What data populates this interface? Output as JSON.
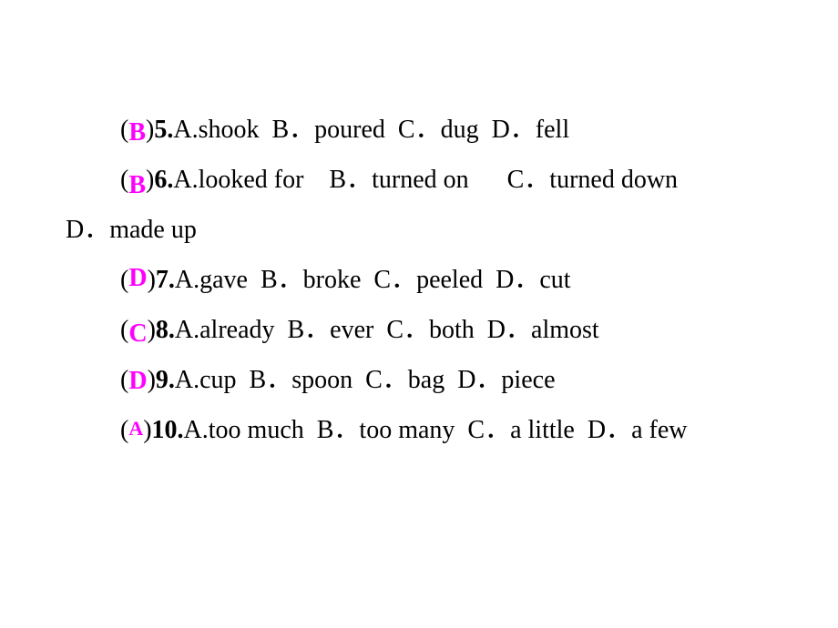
{
  "questions": [
    {
      "answer": "B",
      "number": "5.",
      "text": "A.shook  B．poured  C．dug  D．fell"
    },
    {
      "answer": "B",
      "number": "6.",
      "text": "A.looked for    B．turned on      C．turned down",
      "continuation": "D．made up"
    },
    {
      "answer": "D",
      "number": "7.",
      "text": "A.gave  B．broke  C．peeled  D．cut"
    },
    {
      "answer": "C",
      "number": "8.",
      "text": "A.already  B．ever  C．both  D．almost"
    },
    {
      "answer": "D",
      "number": "9.",
      "text": "A.cup  B．spoon  C．bag  D．piece"
    },
    {
      "answer": "A",
      "number": "10.",
      "text": "A.too much  B．too many  C．a little  D．a few"
    }
  ],
  "colors": {
    "answer": "#ff00ff",
    "text": "#000000"
  }
}
